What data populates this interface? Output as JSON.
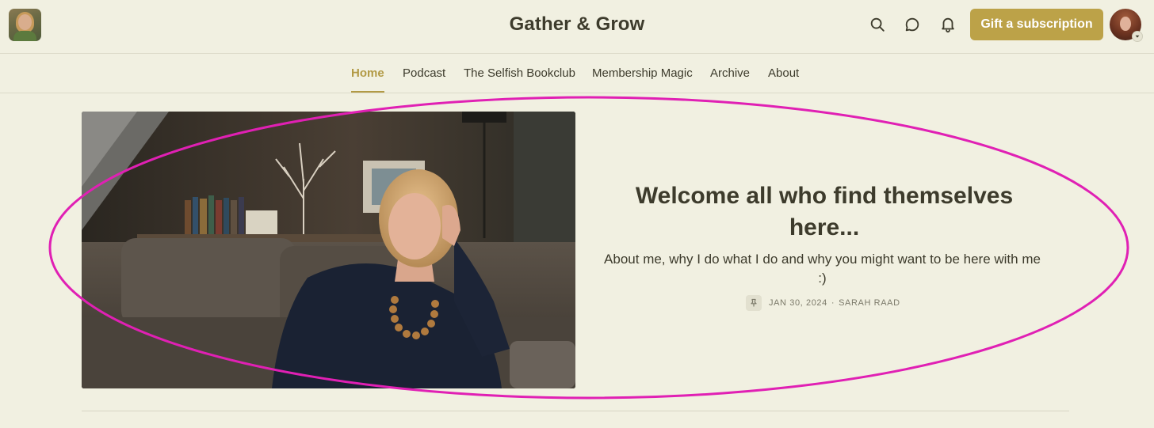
{
  "header": {
    "site_title": "Gather & Grow",
    "gift_button_label": "Gift a subscription",
    "icons": [
      "search-icon",
      "chat-icon",
      "bell-icon"
    ]
  },
  "nav": {
    "items": [
      {
        "label": "Home",
        "active": true
      },
      {
        "label": "Podcast",
        "active": false
      },
      {
        "label": "The Selfish Bookclub",
        "active": false
      },
      {
        "label": "Membership Magic",
        "active": false
      },
      {
        "label": "Archive",
        "active": false
      },
      {
        "label": "About",
        "active": false
      }
    ]
  },
  "hero": {
    "title": "Welcome all who find themselves here...",
    "subtitle": "About me, why I do what I do and why you might want to be here with me :)",
    "date": "JAN 30, 2024",
    "separator": "·",
    "author": "SARAH RAAD",
    "pinned_icon": "pin-icon"
  },
  "colors": {
    "background": "#f1f0e1",
    "accent": "#bca248",
    "text": "#3d3b2c",
    "annotation": "#e020b4"
  }
}
